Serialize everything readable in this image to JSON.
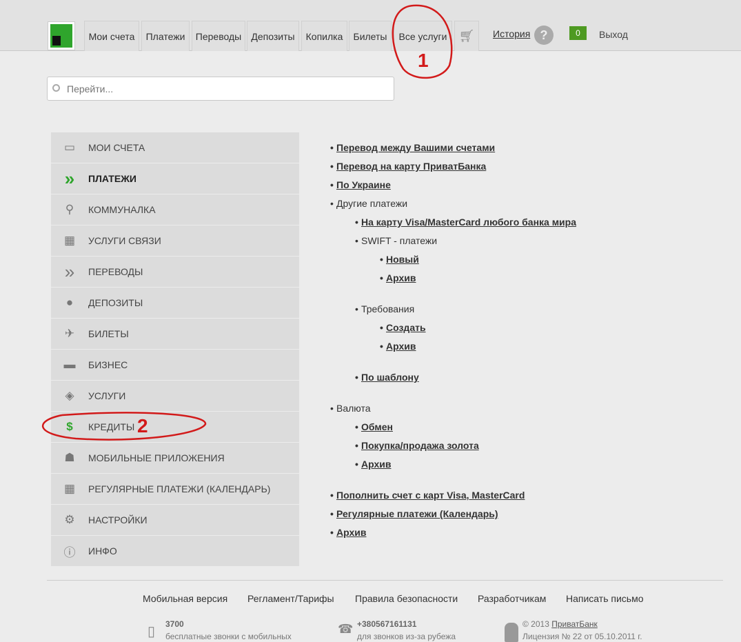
{
  "nav": {
    "tabs": [
      "Мои счета",
      "Платежи",
      "Переводы",
      "Депозиты",
      "Копилка",
      "Билеты",
      "Все услуги"
    ],
    "history": "История",
    "help_icon": "?",
    "messages_count": "0",
    "logout": "Выход"
  },
  "search": {
    "placeholder": "Перейти..."
  },
  "sidebar": {
    "items": [
      {
        "label": "МОИ СЧЕТА",
        "icon": "card-icon"
      },
      {
        "label": "ПЛАТЕЖИ",
        "icon": "double-chevron-icon",
        "active": true
      },
      {
        "label": "КОММУНАЛКА",
        "icon": "faucet-icon"
      },
      {
        "label": "УСЛУГИ СВЯЗИ",
        "icon": "phone-icon"
      },
      {
        "label": "ПЕРЕВОДЫ",
        "icon": "double-chevron-icon"
      },
      {
        "label": "ДЕПОЗИТЫ",
        "icon": "piggy-bank-icon"
      },
      {
        "label": "БИЛЕТЫ",
        "icon": "tickets-icon"
      },
      {
        "label": "БИЗНЕС",
        "icon": "briefcase-icon"
      },
      {
        "label": "УСЛУГИ",
        "icon": "box-icon"
      },
      {
        "label": "КРЕДИТЫ",
        "icon": "money-bag-icon"
      },
      {
        "label": "МОБИЛЬНЫЕ ПРИЛОЖЕНИЯ",
        "icon": "android-icon"
      },
      {
        "label": "РЕГУЛЯРНЫЕ ПЛАТЕЖИ (КАЛЕНДАРЬ)",
        "icon": "calendar-icon"
      },
      {
        "label": "НАСТРОЙКИ",
        "icon": "gear-icon"
      },
      {
        "label": "ИНФО",
        "icon": "info-icon"
      }
    ]
  },
  "menu": [
    {
      "t": "Перевод между Вашими счетами",
      "l": 0,
      "link": true
    },
    {
      "t": "Перевод на карту ПриватБанка",
      "l": 0,
      "link": true
    },
    {
      "t": "По Украине",
      "l": 0,
      "link": true
    },
    {
      "t": "Другие платежи",
      "l": 0,
      "link": false
    },
    {
      "t": "На карту Visa/MasterCard любого банка мира",
      "l": 1,
      "link": true
    },
    {
      "t": "SWIFT - платежи",
      "l": 1,
      "link": false
    },
    {
      "t": "Новый",
      "l": 2,
      "link": true
    },
    {
      "t": "Архив",
      "l": 2,
      "link": true
    },
    {
      "t": "Требования",
      "l": 1,
      "link": false,
      "gap": 1
    },
    {
      "t": "Создать",
      "l": 2,
      "link": true
    },
    {
      "t": "Архив",
      "l": 2,
      "link": true
    },
    {
      "t": "По шаблону",
      "l": 1,
      "link": true,
      "gap": 1
    },
    {
      "t": "Валюта",
      "l": 0,
      "link": false,
      "gap": 1
    },
    {
      "t": "Обмен",
      "l": 1,
      "link": true
    },
    {
      "t": "Покупка/продажа золота",
      "l": 1,
      "link": true
    },
    {
      "t": "Архив",
      "l": 1,
      "link": true
    },
    {
      "t": "Пополнить счет с карт Visa, MasterCard",
      "l": 0,
      "link": true,
      "gap": 1
    },
    {
      "t": "Регулярные платежи (Календарь)",
      "l": 0,
      "link": true
    },
    {
      "t": "Архив",
      "l": 0,
      "link": true
    }
  ],
  "footer": {
    "links": [
      "Мобильная версия",
      "Регламент/Тарифы",
      "Правила безопасности",
      "Разработчикам",
      "Написать письмо"
    ],
    "phone_short": "3700",
    "phone_short_note": "бесплатные звонки с мобильных",
    "phone_intl": "+380567161131",
    "phone_intl_note": "для звонков из-за рубежа",
    "copyright": "© 2013",
    "bank": "ПриватБанк",
    "license": "Лицензия № 22 от 05.10.2011 г."
  },
  "annotations": [
    "1",
    "2"
  ]
}
